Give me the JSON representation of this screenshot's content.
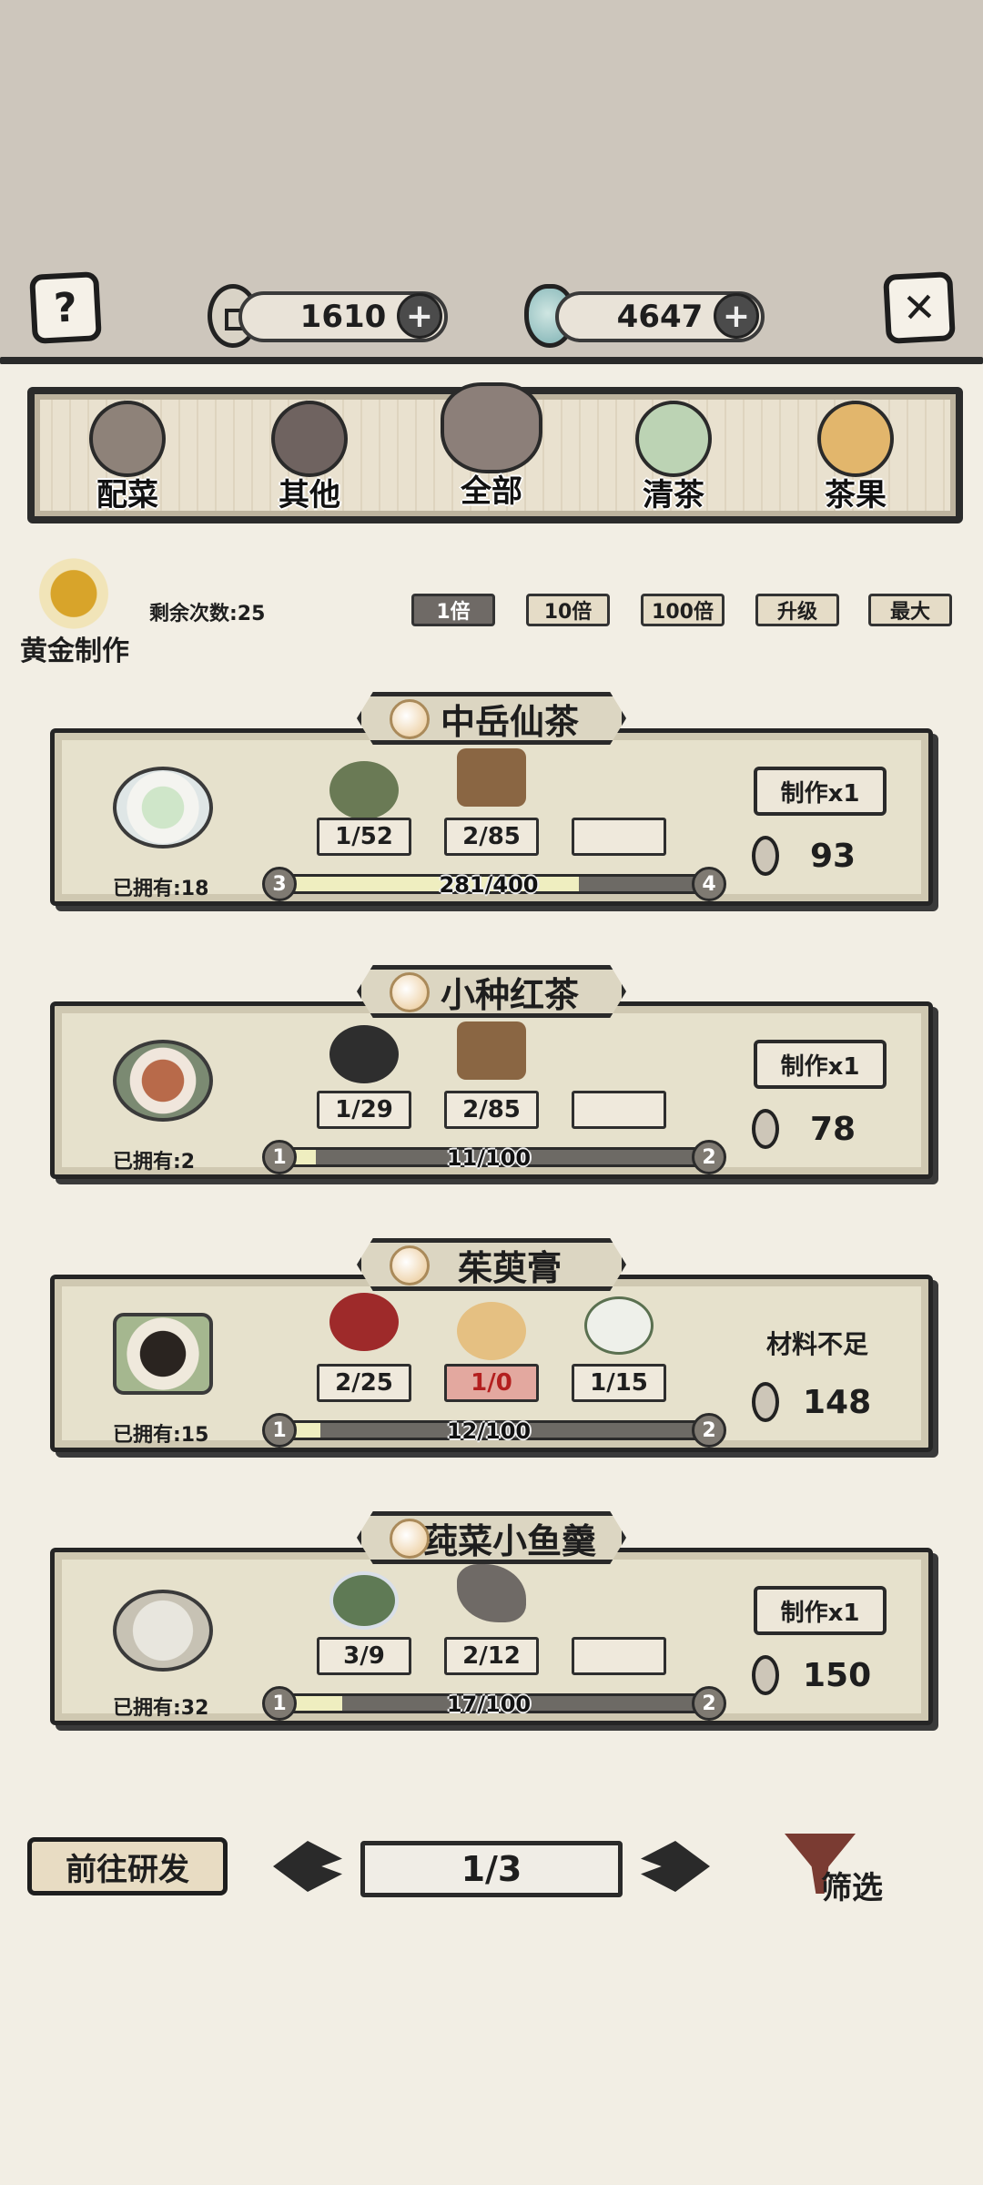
{
  "top": {
    "help_icon": "?",
    "close_icon": "✕",
    "coins": "1610",
    "gems": "4647",
    "plus": "+"
  },
  "categories": [
    {
      "label": "配菜",
      "icon": "fish-plate-icon"
    },
    {
      "label": "其他",
      "icon": "mortar-icon"
    },
    {
      "label": "全部",
      "icon": "pig-face-icon",
      "active": true
    },
    {
      "label": "清茶",
      "icon": "tea-cup-icon"
    },
    {
      "label": "茶果",
      "icon": "pastry-icon"
    }
  ],
  "golden": {
    "label": "黄金制作",
    "remaining": "剩余次数:25"
  },
  "multipliers": [
    "1倍",
    "10倍",
    "100倍",
    "升级",
    "最大"
  ],
  "recipes": [
    {
      "name": "中岳仙茶",
      "owned": "已拥有:18",
      "ingredients": [
        "1/52",
        "2/85",
        ""
      ],
      "action": "制作x1",
      "price": "93",
      "progress": {
        "text": "281/400",
        "fraction": 0.7025,
        "from": "3",
        "to": "4"
      }
    },
    {
      "name": "小种红茶",
      "owned": "已拥有:2",
      "ingredients": [
        "1/29",
        "2/85",
        ""
      ],
      "action": "制作x1",
      "price": "78",
      "progress": {
        "text": "11/100",
        "fraction": 0.11,
        "from": "1",
        "to": "2"
      }
    },
    {
      "name": "茱萸膏",
      "owned": "已拥有:15",
      "ingredients": [
        "2/25",
        "1/0",
        "1/15"
      ],
      "action": "材料不足",
      "price": "148",
      "progress": {
        "text": "12/100",
        "fraction": 0.12,
        "from": "1",
        "to": "2"
      }
    },
    {
      "name": "莼菜小鱼羹",
      "owned": "已拥有:32",
      "ingredients": [
        "3/9",
        "2/12",
        ""
      ],
      "action": "制作x1",
      "price": "150",
      "progress": {
        "text": "17/100",
        "fraction": 0.17,
        "from": "1",
        "to": "2"
      }
    }
  ],
  "bottom": {
    "research": "前往研发",
    "page": "1/3",
    "filter": "筛选"
  },
  "colors": {
    "top_bg": "#cdc6bc",
    "page_bg": "#f2eee4",
    "card_bg": "#e6e1cc",
    "lack_red": "#b31f1f",
    "progress_fill": "#efeec0"
  }
}
